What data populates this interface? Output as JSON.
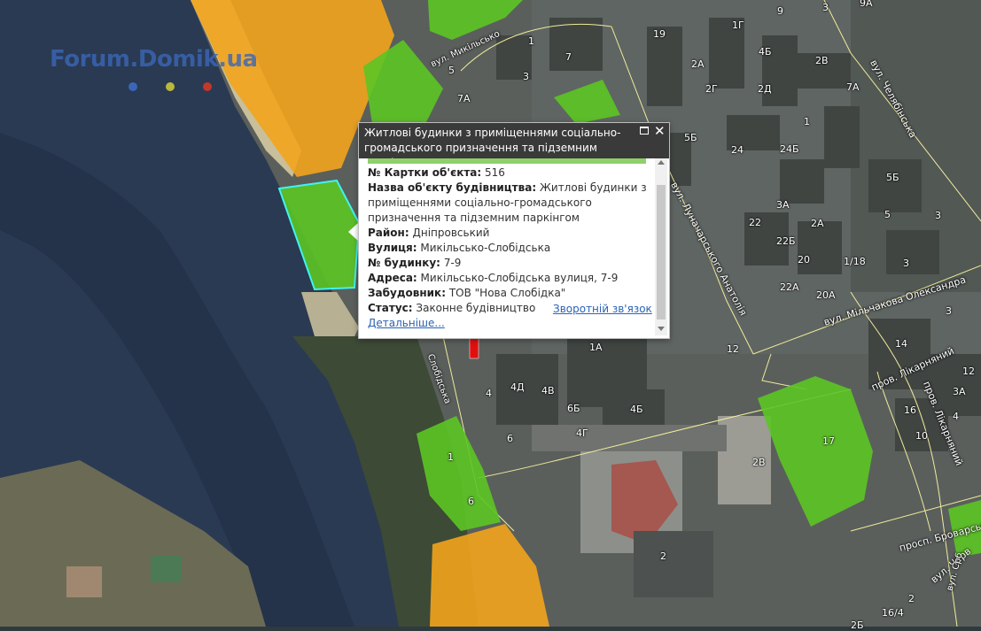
{
  "logo": {
    "text": "Forum.Domik.ua",
    "dot_colors": [
      "#3b66b8",
      "#b8b83b",
      "#c0392b"
    ]
  },
  "colors": {
    "residential_green": "#5cc524",
    "commercial_orange": "#f2a41c",
    "selected_outline": "#3ff3f3",
    "popup_bar": "#8fd06a",
    "annotation_arrow": "#e01010"
  },
  "streets": [
    {
      "id": "vul-mykilsko-top",
      "text": "вул. Микільсько"
    },
    {
      "id": "vul-anatoliia",
      "text": "вул. Луначарського Анатолія"
    },
    {
      "id": "vul-chelyabinska",
      "text": "вул. Челябінська"
    },
    {
      "id": "vul-milchakova",
      "text": "вул. Мільчакова Олександра"
    },
    {
      "id": "prov-likarnianyi-1",
      "text": "пров. Лікарняний"
    },
    {
      "id": "prov-likarnianyi-2",
      "text": "пров. Лікарняний"
    },
    {
      "id": "prov-ervarskyi",
      "text": "просп. Броварський"
    },
    {
      "id": "vul-chervo",
      "text": "вул. Черв"
    },
    {
      "id": "vul-sloboda-left",
      "text": "Слобідська"
    },
    {
      "id": "vul-right-bottom",
      "text": "вул. Срб"
    }
  ],
  "building_numbers": [
    "1",
    "3",
    "5",
    "7",
    "7А",
    "19",
    "1Г",
    "4Б",
    "3",
    "9",
    "9А",
    "2А",
    "2Г",
    "2В",
    "2Д",
    "7А",
    "1",
    "5Б",
    "24",
    "24Б",
    "5Б",
    "5",
    "3",
    "3А",
    "22",
    "22Б",
    "22А",
    "20",
    "20А",
    "1/18",
    "3",
    "3",
    "2А",
    "3А",
    "12",
    "1А",
    "4",
    "4Д",
    "4В",
    "6Б",
    "6",
    "4Г",
    "4Б",
    "2В",
    "17",
    "2",
    "16",
    "10",
    "4",
    "12",
    "14",
    "16/4",
    "2",
    "2Б",
    "1",
    "6",
    "5",
    "6",
    "6",
    "4"
  ],
  "popup": {
    "title": "Житлові будинки з приміщеннями соціально-громадського призначення та підземним паркінгом",
    "rows": [
      {
        "label": "№ Картки об'єкта:",
        "value": "516"
      },
      {
        "label": "Назва об'єкту будівництва:",
        "value": "Житлові будинки з приміщеннями соціально-громадського призначення та підземним паркінгом"
      },
      {
        "label": "Район:",
        "value": "Дніпровський"
      },
      {
        "label": "Вулиця:",
        "value": "Микільсько-Слобідська"
      },
      {
        "label": "№ будинку:",
        "value": "7-9"
      },
      {
        "label": "Адреса:",
        "value": "Микільсько-Слобідська вулиця, 7-9"
      },
      {
        "label": "Забудовник:",
        "value": "ТОВ \"Нова Слобідка\""
      },
      {
        "label": "Статус:",
        "value": "Законне будівництво"
      }
    ],
    "feedback_link": "Зворотній зв'язок",
    "more_link": "Детальніше...",
    "maximize_icon": "maximize-icon",
    "close_icon": "close-icon",
    "close_glyph": "✕"
  }
}
